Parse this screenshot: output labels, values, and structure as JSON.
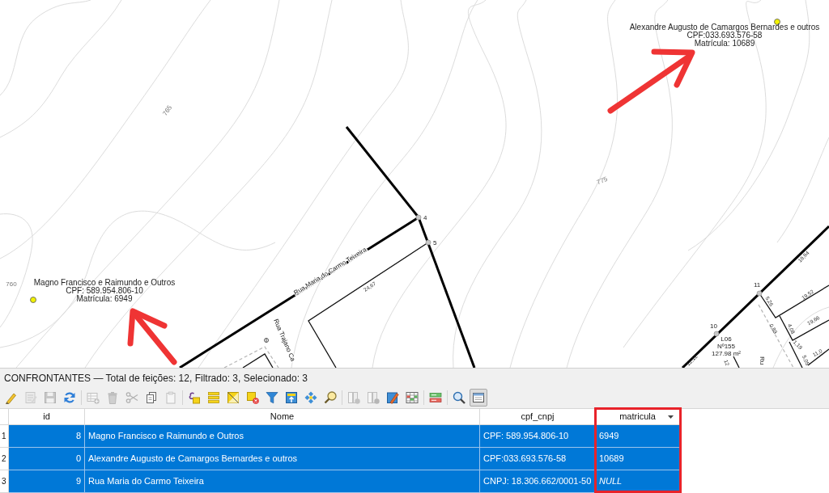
{
  "map": {
    "contour_labels": [
      "765",
      "775",
      "760"
    ],
    "owner_labels": [
      {
        "name": "Alexandre Augusto de Camargos Bernardes e outros",
        "document": "CPF:033.693.576-58",
        "registration": "Matrícula: 10689"
      },
      {
        "name": "Magno Francisco e Raimundo e Outros",
        "document": "CPF: 589.954.806-10",
        "registration": "Matrícula: 6949"
      }
    ],
    "vertex_labels": [
      "4",
      "5",
      "11",
      "10"
    ],
    "street_labels": [
      "Rua Maria do Carmo Teixeira",
      "Rua Trajano Ca",
      "Ru"
    ],
    "dimension_labels": [
      "24,67",
      "19,94",
      "19,52",
      "19,66",
      "5,26",
      "0,89",
      "4,08",
      "1,19",
      "11,0",
      "12,12",
      "5,05",
      "12"
    ],
    "lot_label": {
      "lot": "L06",
      "number": "Nº155",
      "area": "127.98 m²"
    }
  },
  "attribute_table": {
    "title": "CONFRONTANTES — Total de feições: 12, Filtrado: 3, Selecionado: 3",
    "toolbar_groups": [
      [
        {
          "disabled": false,
          "pressed": false
        },
        {
          "disabled": true,
          "pressed": false
        },
        {
          "disabled": true,
          "pressed": false
        },
        {
          "disabled": false,
          "pressed": false
        }
      ],
      [
        {
          "disabled": true,
          "pressed": false
        },
        {
          "disabled": true,
          "pressed": false
        },
        {
          "disabled": true,
          "pressed": false
        },
        {
          "disabled": false,
          "pressed": false
        },
        {
          "disabled": true,
          "pressed": false
        }
      ],
      [
        {
          "disabled": false,
          "pressed": false
        },
        {
          "disabled": false,
          "pressed": false
        },
        {
          "disabled": false,
          "pressed": false
        },
        {
          "disabled": false,
          "pressed": false
        },
        {
          "disabled": false,
          "pressed": false
        },
        {
          "disabled": false,
          "pressed": false
        },
        {
          "disabled": false,
          "pressed": false
        },
        {
          "disabled": false,
          "pressed": false
        }
      ],
      [
        {
          "disabled": true,
          "pressed": false
        },
        {
          "disabled": true,
          "pressed": false
        },
        {
          "disabled": false,
          "pressed": false
        },
        {
          "disabled": false,
          "pressed": false
        }
      ],
      [
        {
          "disabled": false,
          "pressed": false
        }
      ],
      [
        {
          "disabled": false,
          "pressed": false
        },
        {
          "disabled": false,
          "pressed": true
        }
      ]
    ],
    "columns": [
      {
        "label": "id",
        "sorted": false,
        "highlighted": false
      },
      {
        "label": "Nome",
        "sorted": false,
        "highlighted": false
      },
      {
        "label": "cpf_cnpj",
        "sorted": false,
        "highlighted": false
      },
      {
        "label": "matricula",
        "sorted": true,
        "highlighted": true
      }
    ],
    "rows": [
      {
        "number": "1",
        "selected": true,
        "cells": [
          {
            "text": "8",
            "is_null": false
          },
          {
            "text": "Magno Francisco e Raimundo e Outros",
            "is_null": false
          },
          {
            "text": "CPF: 589.954.806-10",
            "is_null": false
          },
          {
            "text": "6949",
            "is_null": false
          }
        ]
      },
      {
        "number": "2",
        "selected": true,
        "cells": [
          {
            "text": "0",
            "is_null": false
          },
          {
            "text": "Alexandre Augusto de Camargos Bernardes e outros",
            "is_null": false
          },
          {
            "text": "CPF:033.693.576-58",
            "is_null": false
          },
          {
            "text": "10689",
            "is_null": false
          }
        ]
      },
      {
        "number": "3",
        "selected": true,
        "cells": [
          {
            "text": "9",
            "is_null": false
          },
          {
            "text": "Rua Maria do Carmo Teixeira",
            "is_null": false
          },
          {
            "text": "CNPJ: 18.306.662/0001-50",
            "is_null": false
          },
          {
            "text": "NULL",
            "is_null": true
          }
        ]
      }
    ]
  }
}
